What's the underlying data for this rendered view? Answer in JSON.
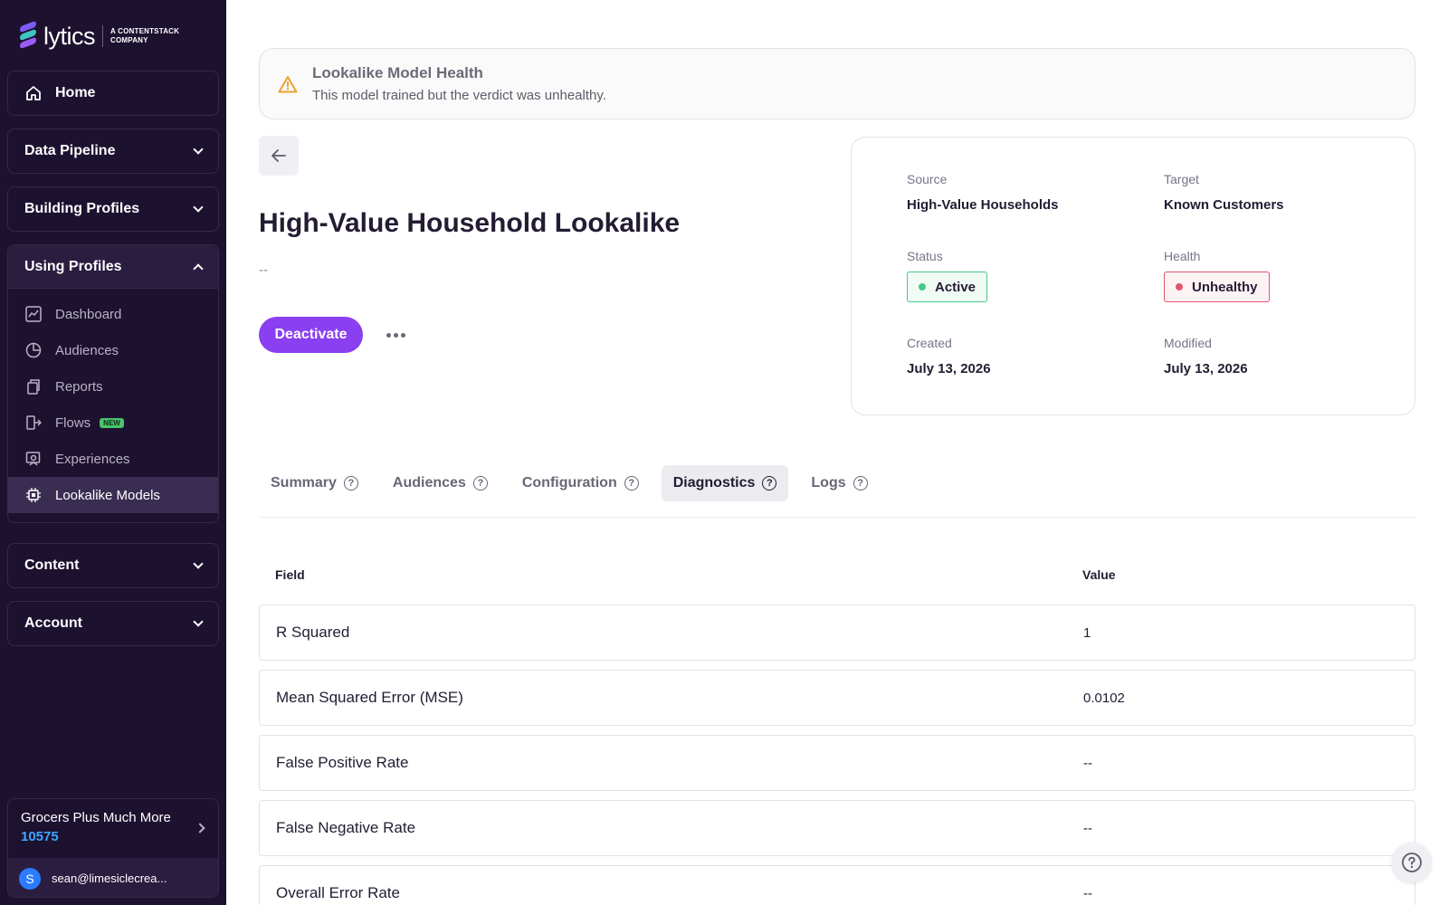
{
  "brand": {
    "name": "lytics",
    "tagline_line1": "A CONTENTSTACK",
    "tagline_line2": "COMPANY"
  },
  "sidebar": {
    "home": "Home",
    "sections": [
      {
        "label": "Data Pipeline"
      },
      {
        "label": "Building Profiles"
      },
      {
        "label": "Using Profiles"
      },
      {
        "label": "Content"
      },
      {
        "label": "Account"
      }
    ],
    "using_profiles_items": [
      {
        "label": "Dashboard",
        "icon": "chart-icon"
      },
      {
        "label": "Audiences",
        "icon": "pie-icon"
      },
      {
        "label": "Reports",
        "icon": "copy-icon"
      },
      {
        "label": "Flows",
        "icon": "flow-icon",
        "badge": "NEW"
      },
      {
        "label": "Experiences",
        "icon": "experience-icon"
      },
      {
        "label": "Lookalike Models",
        "icon": "chip-icon"
      }
    ],
    "account": {
      "name": "Grocers Plus Much More",
      "id": "10575",
      "user_initial": "S",
      "user_email": "sean@limesiclecrea..."
    }
  },
  "alert": {
    "title": "Lookalike Model Health",
    "message": "This model trained but the verdict was unhealthy."
  },
  "model": {
    "title": "High-Value Household Lookalike",
    "description": "--",
    "action_label": "Deactivate"
  },
  "info": {
    "source_label": "Source",
    "source_value": "High-Value Households",
    "target_label": "Target",
    "target_value": "Known Customers",
    "status_label": "Status",
    "status_value": "Active",
    "health_label": "Health",
    "health_value": "Unhealthy",
    "created_label": "Created",
    "created_value": "July 13, 2026",
    "modified_label": "Modified",
    "modified_value": "July 13, 2026"
  },
  "tabs": [
    {
      "label": "Summary"
    },
    {
      "label": "Audiences"
    },
    {
      "label": "Configuration"
    },
    {
      "label": "Diagnostics"
    },
    {
      "label": "Logs"
    }
  ],
  "table": {
    "headers": {
      "field": "Field",
      "value": "Value"
    },
    "rows": [
      {
        "field": "R Squared",
        "value": "1"
      },
      {
        "field": "Mean Squared Error (MSE)",
        "value": "0.0102"
      },
      {
        "field": "False Positive Rate",
        "value": "--"
      },
      {
        "field": "False Negative Rate",
        "value": "--"
      },
      {
        "field": "Overall Error Rate",
        "value": "--"
      }
    ]
  },
  "colors": {
    "sidebar_bg": "#1d1130",
    "accent": "#8a3ff0",
    "active_green": "#45c98a",
    "unhealthy_red": "#e0566e",
    "warning": "#f0a030",
    "account_id": "#3ea6ff"
  }
}
